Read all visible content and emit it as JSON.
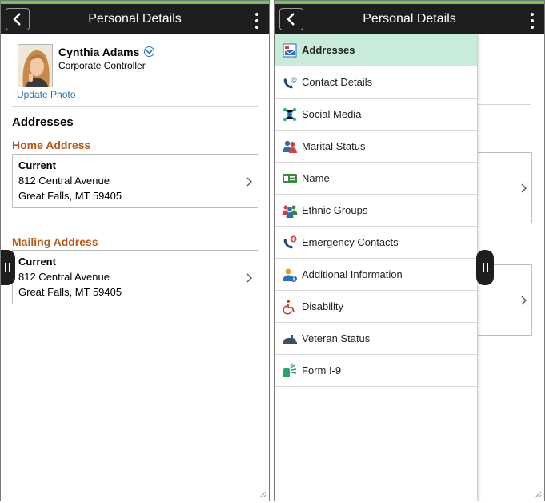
{
  "colors": {
    "accent_green": "#72c55b",
    "link_blue": "#2a6fb0",
    "address_heading": "#b35a1f",
    "active_menu_bg": "#c8ecd9",
    "topbar": "#1e1e1e"
  },
  "left": {
    "header": {
      "title": "Personal Details"
    },
    "employee": {
      "name": "Cynthia Adams",
      "title": "Corporate Controller",
      "update_photo": "Update Photo"
    },
    "section_title": "Addresses",
    "home": {
      "heading": "Home Address",
      "status": "Current",
      "line1": "812 Central Avenue",
      "line2": "Great Falls, MT 59405"
    },
    "mailing": {
      "heading": "Mailing Address",
      "status": "Current",
      "line1": "812 Central Avenue",
      "line2": "Great Falls, MT 59405"
    }
  },
  "right": {
    "header": {
      "title": "Personal Details"
    },
    "menu": [
      {
        "label": "Addresses",
        "icon": "addresses-icon",
        "active": true
      },
      {
        "label": "Contact Details",
        "icon": "contact-details-icon"
      },
      {
        "label": "Social Media",
        "icon": "social-media-icon"
      },
      {
        "label": "Marital Status",
        "icon": "marital-status-icon"
      },
      {
        "label": "Name",
        "icon": "name-card-icon"
      },
      {
        "label": "Ethnic Groups",
        "icon": "ethnic-groups-icon"
      },
      {
        "label": "Emergency Contacts",
        "icon": "emergency-contacts-icon"
      },
      {
        "label": "Additional Information",
        "icon": "additional-info-icon"
      },
      {
        "label": "Disability",
        "icon": "disability-icon"
      },
      {
        "label": "Veteran Status",
        "icon": "veteran-status-icon"
      },
      {
        "label": "Form I-9",
        "icon": "form-i9-icon"
      }
    ]
  }
}
